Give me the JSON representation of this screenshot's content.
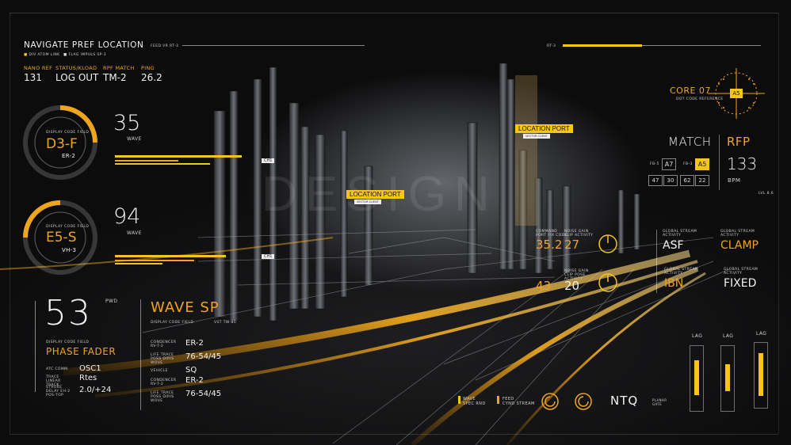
{
  "header": {
    "title": "NAVIGATE PREF LOCATION",
    "sub1": "DIV ATOM LINK",
    "sub2": "FLAG IMPULS SP-3",
    "feed_label": "FEED VR RT-3",
    "rt_label": "RT-3"
  },
  "stats": [
    {
      "label": "NANO REF",
      "value": "131"
    },
    {
      "label": "STATUS/KLOAD",
      "value": "LOG OUT"
    },
    {
      "label": "RPF MATCH",
      "value": "TM-2"
    },
    {
      "label": "PING",
      "value": "26.2"
    }
  ],
  "gauge1": {
    "code": "D3-F",
    "value": "35",
    "unit": "WAVE",
    "sub": "ER-2",
    "field": "DISPLAY CODE FIELD"
  },
  "gauge2": {
    "code": "E5-S",
    "value": "94",
    "unit": "WAVE",
    "sub": "VH-3",
    "field": "DISPLAY CODE FIELD"
  },
  "phase": {
    "value": "53",
    "unit": "PWD",
    "field": "DISPLAY CODE FIELD",
    "title": "PHASE FADER",
    "rows": [
      {
        "k": "ATC COMM",
        "v": "OSC1"
      },
      {
        "k": "TRACE LINEAR TRACK",
        "v": "Rtes"
      },
      {
        "k": "STROKE DELAY EH-2 POS-TOP",
        "v": "2.0/+24"
      }
    ]
  },
  "wave_sp": {
    "title": "WAVE SP",
    "field": "DISPLAY CODE FIELD",
    "vst": "VST TW-80",
    "rows": [
      {
        "k": "CONDENCER RV-T-2",
        "v": "ER-2"
      },
      {
        "k": "LIFE TRACE POSS DIRIS WOVE",
        "v": "76-54/45"
      },
      {
        "k": "VEHICLE",
        "v": "SQ"
      },
      {
        "k": "CONDENCER RV-T-2",
        "v": "ER-2"
      },
      {
        "k": "LIFE TRACE POSS DIRIS WOVE",
        "v": "76-54/45"
      }
    ]
  },
  "ports": [
    {
      "label": "LOCATION PORT",
      "sub": "VECTOR CLIENT"
    },
    {
      "label": "LOCATION PORT",
      "sub": "VECTOR CLIENT"
    }
  ],
  "ch_tags": [
    "CH1",
    "CH1"
  ],
  "core": {
    "label": "CORE 07",
    "sub": "DOT CODE REFERENCE",
    "tag": "A5"
  },
  "match": {
    "label": "MATCH",
    "rfp": "RFP",
    "bpm_value": "133",
    "bpm_unit": "BPM",
    "fb1": "FB-5",
    "box1": "A7",
    "fb2": "FB-3",
    "box2": "A5",
    "grid": [
      "47",
      "30",
      "62",
      "22"
    ],
    "hint": "LVL 8.6"
  },
  "mid_nums": [
    {
      "label": "COMMAND PORT FIX CODE",
      "value": "35.2"
    },
    {
      "label": "NOISE GAIN CLIP ACTIVITY",
      "value": "27"
    },
    {
      "label": "NOISE GAIN CLIP POSE ACTIVITY",
      "value": "43"
    },
    {
      "label": "",
      "value": "20"
    }
  ],
  "streams": [
    {
      "label": "GLOBAL STREAM ACTIVITY",
      "value": "ASF",
      "color": "#f2f2f2"
    },
    {
      "label": "GLOBAL STREAM ACTIVITY",
      "value": "CLAMP",
      "color": "#f0a51e"
    },
    {
      "label": "GLOBAL STREAM ACTIVITY",
      "value": "IBN",
      "color": "#f0a51e"
    },
    {
      "label": "GLOBAL STREAM ACTIVITY",
      "value": "FIXED",
      "color": "#f2f2f2"
    }
  ],
  "footer": {
    "wave": "WAVE",
    "wave_sub": "SPEC RND",
    "feed": "FEED",
    "feed_sub": "CYND STREAM",
    "ntq": "NTQ",
    "ntq_sub": "PLANAR GATE"
  },
  "lag": {
    "label": "LAG",
    "levels": [
      0.55,
      0.42,
      0.68
    ]
  },
  "watermark": "DESIGN"
}
